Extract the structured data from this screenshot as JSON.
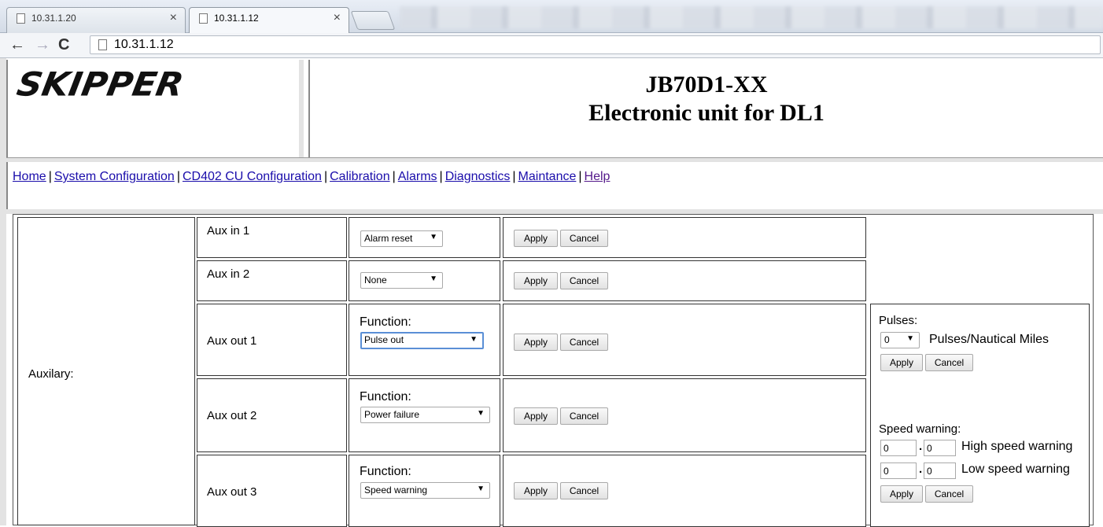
{
  "browser": {
    "tabs": [
      {
        "title": "10.31.1.20",
        "active": false
      },
      {
        "title": "10.31.1.12",
        "active": true
      }
    ],
    "address": "10.31.1.12",
    "close_glyph": "×",
    "back_glyph": "←",
    "forward_glyph": "→",
    "reload_glyph": "C"
  },
  "header": {
    "logo_text": "SKIPPER",
    "title_line1": "JB70D1-XX",
    "title_line2": "Electronic unit for DL1"
  },
  "menu": {
    "items": [
      {
        "label": "Home"
      },
      {
        "label": "System Configuration"
      },
      {
        "label": "CD402 CU Configuration"
      },
      {
        "label": "Calibration"
      },
      {
        "label": "Alarms"
      },
      {
        "label": "Diagnostics"
      },
      {
        "label": "Maintance"
      },
      {
        "label": "Help"
      }
    ],
    "separator": "|"
  },
  "config": {
    "section_label": "Auxilary:",
    "function_label": "Function:",
    "apply_label": "Apply",
    "cancel_label": "Cancel",
    "rows": [
      {
        "name": "Aux in 1",
        "value": "Alarm reset"
      },
      {
        "name": "Aux in 2",
        "value": "None"
      },
      {
        "name": "Aux out 1",
        "value": "Pulse out"
      },
      {
        "name": "Aux out 2",
        "value": "Power failure"
      },
      {
        "name": "Aux out 3",
        "value": "Speed warning"
      }
    ],
    "pulses": {
      "label": "Pulses:",
      "value": "0",
      "unit": "Pulses/Nautical Miles"
    },
    "speed_warning": {
      "label": "Speed warning:",
      "dot": ".",
      "high": {
        "int": "0",
        "dec": "0",
        "label": "High speed warning"
      },
      "low": {
        "int": "0",
        "dec": "0",
        "label": "Low speed warning"
      }
    },
    "arrow_glyph": "▼"
  }
}
